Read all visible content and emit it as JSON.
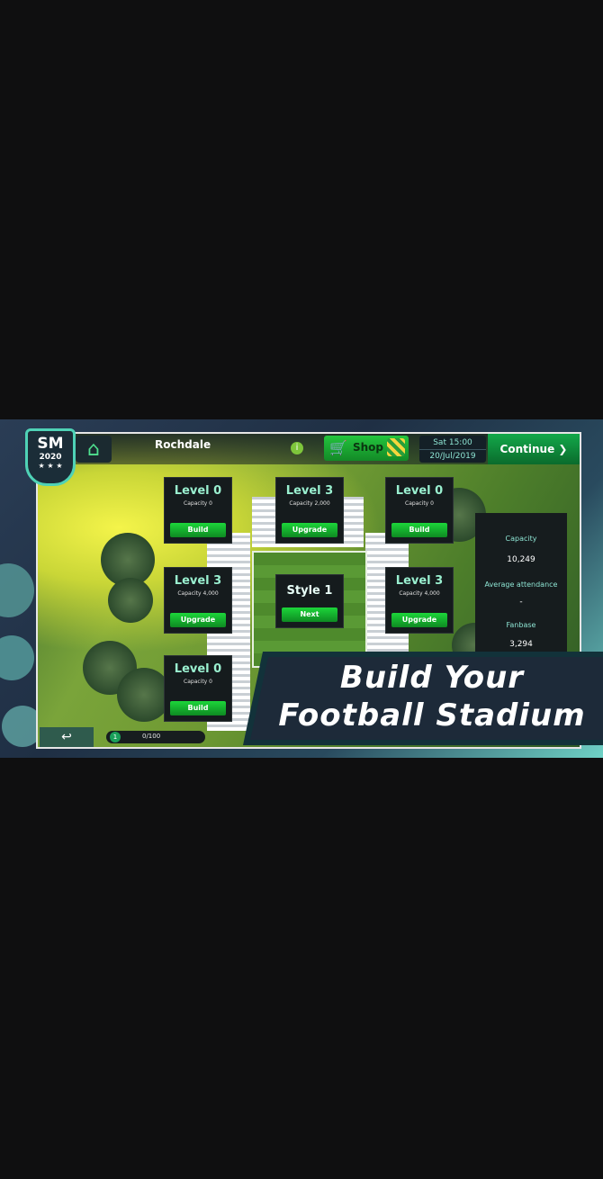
{
  "top_bar": {
    "logo_main": "SM",
    "logo_year": "2020",
    "logo_stars": "★ ★ ★",
    "club_name": "Rochdale",
    "info_label": "i",
    "shop_label": "Shop",
    "date_time": "Sat 15:00",
    "date": "20/Jul/2019",
    "continue_label": "Continue ❯"
  },
  "stands": [
    {
      "level": "Level 0",
      "capacity": "Capacity 0",
      "action": "Build"
    },
    {
      "level": "Level 3",
      "capacity": "Capacity 2,000",
      "action": "Upgrade"
    },
    {
      "level": "Level 0",
      "capacity": "Capacity 0",
      "action": "Build"
    },
    {
      "level": "Level 3",
      "capacity": "Capacity 4,000",
      "action": "Upgrade"
    },
    {
      "level": "Level 3",
      "capacity": "Capacity 4,000",
      "action": "Upgrade"
    },
    {
      "level": "Level 0",
      "capacity": "Capacity 0",
      "action": "Build"
    }
  ],
  "pitch_style": {
    "label": "Style 1",
    "action": "Next"
  },
  "stats": {
    "capacity_label": "Capacity",
    "capacity_value": "10,249",
    "attendance_label": "Average attendance",
    "attendance_value": "-",
    "fanbase_label": "Fanbase",
    "fanbase_value": "3,294"
  },
  "bottom_bar": {
    "back_icon": "↩",
    "badge_number": "1",
    "progress_text": "0/100"
  },
  "headline": {
    "line1": "Build Your",
    "line2": "Football Stadium"
  },
  "colors": {
    "accent_green": "#1cd63a",
    "accent_teal": "#4fd2b6",
    "panel_dark": "#151b1d"
  }
}
